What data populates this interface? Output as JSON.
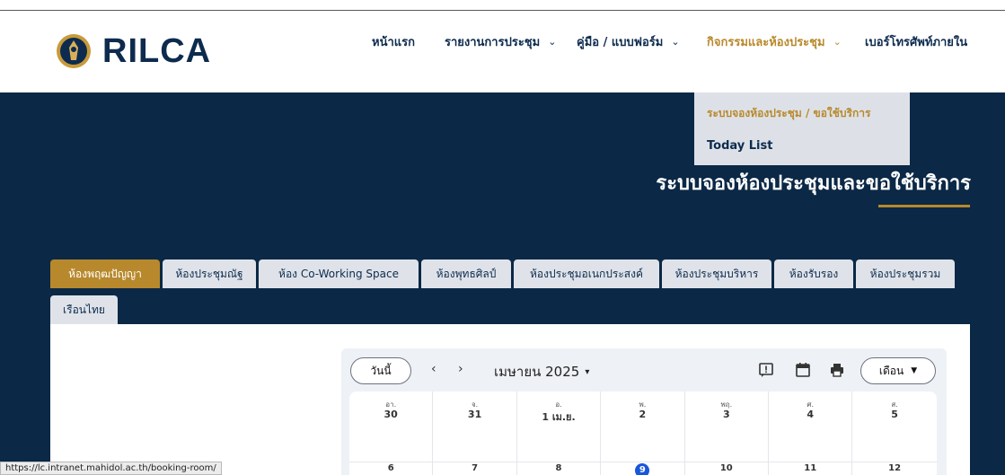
{
  "logo": {
    "text": "RILCA"
  },
  "nav": {
    "items": [
      {
        "label": "หน้าแรก",
        "has_dropdown": false,
        "active": false
      },
      {
        "label": "รายงานการประชุม",
        "has_dropdown": true,
        "active": false
      },
      {
        "label": "คู่มือ / แบบฟอร์ม",
        "has_dropdown": true,
        "active": false
      },
      {
        "label": "กิจกรรมและห้องประชุม",
        "has_dropdown": true,
        "active": true
      },
      {
        "label": "เบอร์โทรศัพท์ภายใน",
        "has_dropdown": false,
        "active": false
      }
    ],
    "chevron": "⌄"
  },
  "dropdown": {
    "items": [
      {
        "label": "ระบบจองห้องประชุม / ขอใช้บริการ",
        "active": true
      },
      {
        "label": "Today List",
        "active": false
      }
    ]
  },
  "hero": {
    "title": "ระบบจองห้องประชุมและขอใช้บริการ"
  },
  "tabs": [
    {
      "label": "ห้องพฤฒปัญญา",
      "active": true
    },
    {
      "label": "ห้องประชุมณัฐ",
      "active": false
    },
    {
      "label": "ห้อง Co-Working Space",
      "active": false
    },
    {
      "label": "ห้องพุทธศิลป์",
      "active": false
    },
    {
      "label": "ห้องประชุมอเนกประสงค์",
      "active": false
    },
    {
      "label": "ห้องประชุมบริหาร",
      "active": false
    },
    {
      "label": "ห้องรับรอง",
      "active": false
    },
    {
      "label": "ห้องประชุมรวม",
      "active": false
    },
    {
      "label": "เรือนไทย",
      "active": false
    }
  ],
  "calendar": {
    "today_label": "วันนี้",
    "prev": "‹",
    "next": "›",
    "month_label": "เมษายน 2025",
    "view_label": "เดือน",
    "icons": [
      "feedback-icon",
      "calendar-icon",
      "print-icon"
    ],
    "days": [
      {
        "dow": "อา.",
        "date": "30",
        "next": "6",
        "today": false
      },
      {
        "dow": "จ.",
        "date": "31",
        "next": "7",
        "today": false
      },
      {
        "dow": "อ.",
        "date": "1 เม.ย.",
        "next": "8",
        "today": false
      },
      {
        "dow": "พ.",
        "date": "2",
        "next": "9",
        "today": true
      },
      {
        "dow": "พฤ.",
        "date": "3",
        "next": "10",
        "today": false
      },
      {
        "dow": "ศ.",
        "date": "4",
        "next": "11",
        "today": false
      },
      {
        "dow": "ส.",
        "date": "5",
        "next": "12",
        "today": false
      }
    ],
    "accent_today": "#1a56db"
  },
  "status_bar": {
    "url": "https://lc.intranet.mahidol.ac.th/booking-room/"
  },
  "colors": {
    "navy": "#0b2846",
    "gold": "#b8892c",
    "tab_bg": "#dfe3e9"
  }
}
